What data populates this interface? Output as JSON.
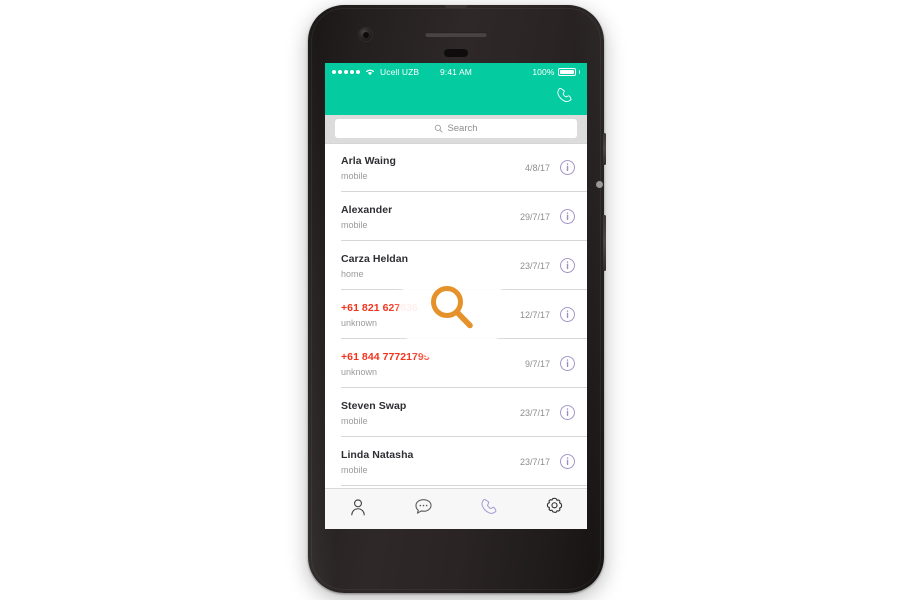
{
  "device": {
    "name": "smartphone-mockup",
    "hardware": {
      "earpiece": "earpiece-speaker",
      "front_camera": "front-camera",
      "sensor": "proximity-sensor",
      "power_button": "power-button",
      "volume_button": "volume-button"
    }
  },
  "status_bar": {
    "signal_dots": 5,
    "wifi_icon": "wifi-icon",
    "carrier": "Ucell UZB",
    "time": "9:41 AM",
    "battery_percent": "100%",
    "battery_icon": "battery-full-icon",
    "background_color": "#05CBA0",
    "text_color": "#ffffff"
  },
  "nav_bar": {
    "call_icon": "phone-handset-icon",
    "background_color": "#05CBA0"
  },
  "search": {
    "placeholder": "Search",
    "icon": "search-icon"
  },
  "magnifier_overlay": {
    "icon": "magnifying-glass-icon",
    "color": "#E5922B"
  },
  "contacts": {
    "info_icon": "info-circle-icon",
    "info_icon_color": "#9d8fc4",
    "missed_color": "#f4331c",
    "items": [
      {
        "name": "Arla Waing",
        "type": "mobile",
        "date": "4/8/17",
        "missed": false
      },
      {
        "name": "Alexander",
        "type": "mobile",
        "date": "29/7/17",
        "missed": false
      },
      {
        "name": "Carza Heldan",
        "type": "home",
        "date": "23/7/17",
        "missed": false
      },
      {
        "name": "+61 821 627836",
        "type": "unknown",
        "date": "12/7/17",
        "missed": true
      },
      {
        "name": "+61 844 77721795",
        "type": "unknown",
        "date": "9/7/17",
        "missed": true
      },
      {
        "name": "Steven Swap",
        "type": "mobile",
        "date": "23/7/17",
        "missed": false
      },
      {
        "name": "Linda Natasha",
        "type": "mobile",
        "date": "23/7/17",
        "missed": false
      }
    ]
  },
  "tab_bar": {
    "active_color": "#a89fd6",
    "inactive_color": "#3c3c3c",
    "items": [
      {
        "label": "Contacts",
        "icon": "person-icon",
        "active": false
      },
      {
        "label": "Messages",
        "icon": "chat-bubble-icon",
        "active": false
      },
      {
        "label": "Calls",
        "icon": "phone-icon",
        "active": true
      },
      {
        "label": "Settings",
        "icon": "gear-icon",
        "active": false
      }
    ]
  }
}
